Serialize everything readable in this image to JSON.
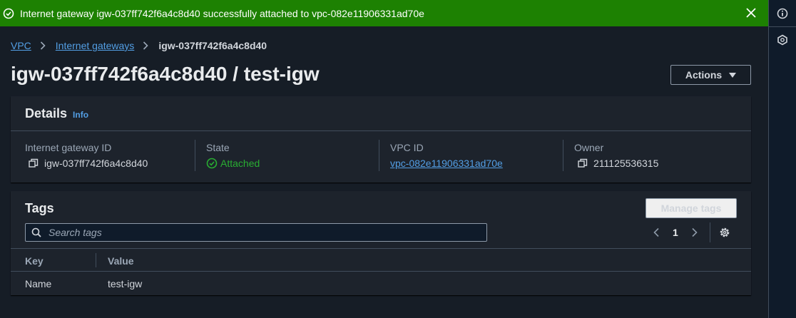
{
  "flash": {
    "message": "Internet gateway igw-037ff742f6a4c8d40 successfully attached to vpc-082e11906331ad70e"
  },
  "breadcrumb": {
    "root": "VPC",
    "section": "Internet gateways",
    "current": "igw-037ff742f6a4c8d40"
  },
  "page": {
    "title": "igw-037ff742f6a4c8d40 / test-igw",
    "actions_label": "Actions"
  },
  "details": {
    "heading": "Details",
    "info_link": "Info",
    "fields": [
      {
        "label": "Internet gateway ID",
        "value": "igw-037ff742f6a4c8d40"
      },
      {
        "label": "State",
        "value": "Attached"
      },
      {
        "label": "VPC ID",
        "value": "vpc-082e11906331ad70e"
      },
      {
        "label": "Owner",
        "value": "211125536315"
      }
    ]
  },
  "tags": {
    "heading": "Tags",
    "manage_label": "Manage tags",
    "search_placeholder": "Search tags",
    "page_number": "1",
    "columns": [
      "Key",
      "Value"
    ],
    "rows": [
      {
        "key": "Name",
        "value": "test-igw"
      }
    ]
  },
  "colors": {
    "success": "#1d8102",
    "link": "#539fe5",
    "state_ok": "#29ad32"
  },
  "icons": [
    "check-circle-icon",
    "close-icon",
    "chevron-right-icon",
    "copy-icon",
    "search-icon",
    "chevron-left-icon",
    "gear-icon",
    "info-icon",
    "feedback-icon",
    "caret-down-icon"
  ]
}
